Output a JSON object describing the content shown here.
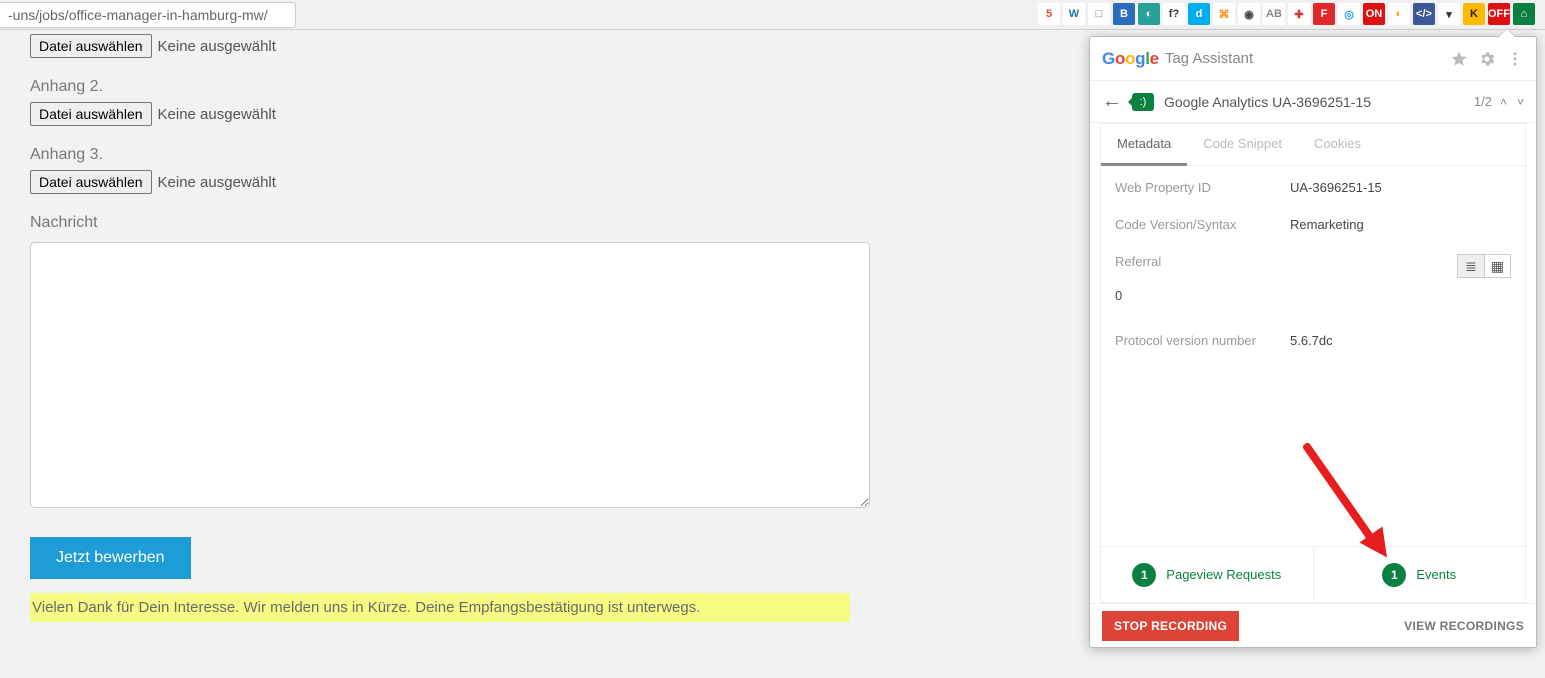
{
  "browser": {
    "url_fragment": "-uns/jobs/office-manager-in-hamburg-mw/"
  },
  "form": {
    "attachments": [
      {
        "label": "",
        "button": "Datei auswählen",
        "status": "Keine ausgewählt"
      },
      {
        "label": "Anhang 2.",
        "button": "Datei auswählen",
        "status": "Keine ausgewählt"
      },
      {
        "label": "Anhang 3.",
        "button": "Datei auswählen",
        "status": "Keine ausgewählt"
      }
    ],
    "message_label": "Nachricht",
    "message_value": "",
    "submit": "Jetzt bewerben",
    "thanks": "Vielen Dank für Dein Interesse. Wir melden uns in Kürze. Deine Empfangsbestätigung ist unterwegs."
  },
  "ta": {
    "title": "Tag Assistant",
    "tag_name": "Google Analytics UA-3696251-15",
    "counter": "1/2",
    "tabs": {
      "metadata": "Metadata",
      "code": "Code Snippet",
      "cookies": "Cookies"
    },
    "meta": {
      "web_property_id_k": "Web Property ID",
      "web_property_id_v": "UA-3696251-15",
      "code_version_k": "Code Version/Syntax",
      "code_version_v": "Remarketing",
      "referral_k": "Referral",
      "referral_v": "0",
      "protocol_k": "Protocol version number",
      "protocol_v": "5.6.7dc"
    },
    "req": {
      "pageview_count": "1",
      "pageview_label": "Pageview Requests",
      "events_count": "1",
      "events_label": "Events"
    },
    "footer": {
      "stop": "STOP RECORDING",
      "view": "VIEW RECORDINGS"
    }
  },
  "ext_icons": [
    {
      "bg": "#fff",
      "fg": "#e44d26",
      "txt": "5"
    },
    {
      "bg": "#fff",
      "fg": "#21759b",
      "txt": "W"
    },
    {
      "bg": "#fff",
      "fg": "#777",
      "txt": "□"
    },
    {
      "bg": "#2a6ebb",
      "fg": "#fff",
      "txt": "B"
    },
    {
      "bg": "#2aa198",
      "fg": "#fff",
      "txt": "◐"
    },
    {
      "bg": "#fff",
      "fg": "#333",
      "txt": "f?"
    },
    {
      "bg": "#00aef0",
      "fg": "#fff",
      "txt": "d"
    },
    {
      "bg": "#fff",
      "fg": "#f78f1e",
      "txt": "⌘"
    },
    {
      "bg": "#fff",
      "fg": "#444",
      "txt": "◉"
    },
    {
      "bg": "#fff",
      "fg": "#888",
      "txt": "AB"
    },
    {
      "bg": "#fff",
      "fg": "#d33",
      "txt": "✚"
    },
    {
      "bg": "#e12828",
      "fg": "#fff",
      "txt": "F"
    },
    {
      "bg": "#fff",
      "fg": "#1da1f2",
      "txt": "◎"
    },
    {
      "bg": "#d11",
      "fg": "#fff",
      "txt": "ON"
    },
    {
      "bg": "#fff",
      "fg": "#f90",
      "txt": "◐"
    },
    {
      "bg": "#3b5998",
      "fg": "#fff",
      "txt": "</>"
    },
    {
      "bg": "#fff",
      "fg": "#333",
      "txt": "▾"
    },
    {
      "bg": "#ffb900",
      "fg": "#222",
      "txt": "K"
    },
    {
      "bg": "#d11",
      "fg": "#fff",
      "txt": "OFF"
    },
    {
      "bg": "#0b8043",
      "fg": "#fff",
      "txt": "⌂"
    }
  ]
}
